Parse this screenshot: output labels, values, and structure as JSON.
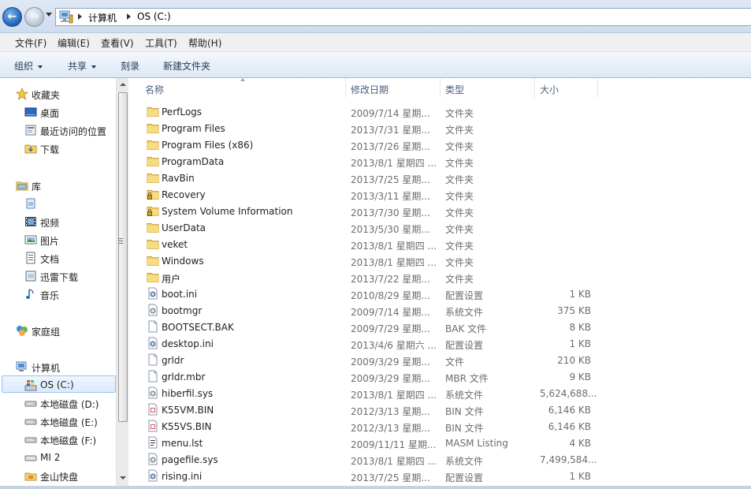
{
  "address": {
    "crumbs": [
      "计算机",
      "OS (C:)"
    ]
  },
  "menu": {
    "items": [
      "文件(F)",
      "编辑(E)",
      "查看(V)",
      "工具(T)",
      "帮助(H)"
    ]
  },
  "commands": {
    "organize": "组织",
    "share": "共享",
    "burn": "刻录",
    "new_folder": "新建文件夹"
  },
  "nav": {
    "favorites": "收藏夹",
    "desktop": "桌面",
    "recent": "最近访问的位置",
    "downloads": "下载",
    "libraries": "库",
    "videos": "视频",
    "pictures": "图片",
    "documents": "文档",
    "xunlei": "迅雷下载",
    "music": "音乐",
    "homegroup": "家庭组",
    "computer": "计算机",
    "drive_c": "OS (C:)",
    "drive_d": "本地磁盘 (D:)",
    "drive_e": "本地磁盘 (E:)",
    "drive_f": "本地磁盘 (F:)",
    "mi2": "MI 2",
    "kuaipan": "金山快盘"
  },
  "columns": {
    "name": "名称",
    "date": "修改日期",
    "type": "类型",
    "size": "大小"
  },
  "files": [
    {
      "name": "PerfLogs",
      "date": "2009/7/14 星期...",
      "type": "文件夹",
      "size": "",
      "icon": "folder-icon"
    },
    {
      "name": "Program Files",
      "date": "2013/7/31 星期...",
      "type": "文件夹",
      "size": "",
      "icon": "folder-icon"
    },
    {
      "name": "Program Files (x86)",
      "date": "2013/7/26 星期...",
      "type": "文件夹",
      "size": "",
      "icon": "folder-icon"
    },
    {
      "name": "ProgramData",
      "date": "2013/8/1 星期四 ...",
      "type": "文件夹",
      "size": "",
      "icon": "folder-icon"
    },
    {
      "name": "RavBin",
      "date": "2013/7/25 星期...",
      "type": "文件夹",
      "size": "",
      "icon": "folder-icon"
    },
    {
      "name": "Recovery",
      "date": "2013/3/11 星期...",
      "type": "文件夹",
      "size": "",
      "icon": "locked-folder-icon"
    },
    {
      "name": "System Volume Information",
      "date": "2013/7/30 星期...",
      "type": "文件夹",
      "size": "",
      "icon": "locked-folder-icon"
    },
    {
      "name": "UserData",
      "date": "2013/5/30 星期...",
      "type": "文件夹",
      "size": "",
      "icon": "folder-icon"
    },
    {
      "name": "veket",
      "date": "2013/8/1 星期四 ...",
      "type": "文件夹",
      "size": "",
      "icon": "folder-icon"
    },
    {
      "name": "Windows",
      "date": "2013/8/1 星期四 ...",
      "type": "文件夹",
      "size": "",
      "icon": "folder-icon"
    },
    {
      "name": "用户",
      "date": "2013/7/22 星期...",
      "type": "文件夹",
      "size": "",
      "icon": "folder-icon"
    },
    {
      "name": "boot.ini",
      "date": "2010/8/29 星期...",
      "type": "配置设置",
      "size": "1 KB",
      "icon": "config-file-icon"
    },
    {
      "name": "bootmgr",
      "date": "2009/7/14 星期...",
      "type": "系统文件",
      "size": "375 KB",
      "icon": "system-file-icon"
    },
    {
      "name": "BOOTSECT.BAK",
      "date": "2009/7/29 星期...",
      "type": "BAK 文件",
      "size": "8 KB",
      "icon": "blank-file-icon"
    },
    {
      "name": "desktop.ini",
      "date": "2013/4/6 星期六 ...",
      "type": "配置设置",
      "size": "1 KB",
      "icon": "config-file-icon"
    },
    {
      "name": "grldr",
      "date": "2009/3/29 星期...",
      "type": "文件",
      "size": "210 KB",
      "icon": "blank-file-icon"
    },
    {
      "name": "grldr.mbr",
      "date": "2009/3/29 星期...",
      "type": "MBR 文件",
      "size": "9 KB",
      "icon": "blank-file-icon"
    },
    {
      "name": "hiberfil.sys",
      "date": "2013/8/1 星期四 ...",
      "type": "系统文件",
      "size": "5,624,688...",
      "icon": "system-file-icon"
    },
    {
      "name": "K55VM.BIN",
      "date": "2012/3/13 星期...",
      "type": "BIN 文件",
      "size": "6,146 KB",
      "icon": "bin-file-icon"
    },
    {
      "name": "K55VS.BIN",
      "date": "2012/3/13 星期...",
      "type": "BIN 文件",
      "size": "6,146 KB",
      "icon": "bin-file-icon"
    },
    {
      "name": "menu.lst",
      "date": "2009/11/11 星期...",
      "type": "MASM Listing",
      "size": "4 KB",
      "icon": "listing-file-icon"
    },
    {
      "name": "pagefile.sys",
      "date": "2013/8/1 星期四 ...",
      "type": "系统文件",
      "size": "7,499,584...",
      "icon": "system-file-icon"
    },
    {
      "name": "rising.ini",
      "date": "2013/7/25 星期...",
      "type": "配置设置",
      "size": "1 KB",
      "icon": "config-file-icon"
    }
  ]
}
